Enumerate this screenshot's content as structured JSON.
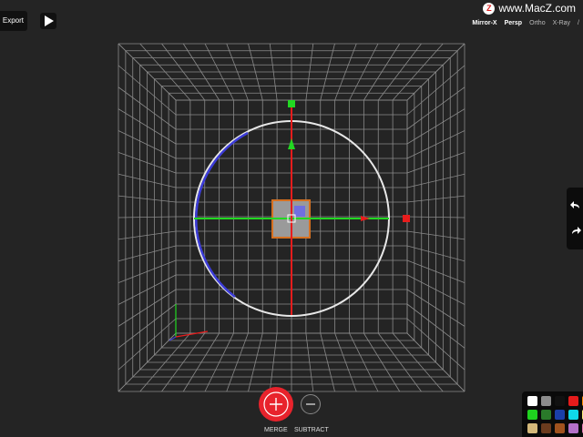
{
  "toolbar": {
    "export_label": "Export",
    "play_icon": "play-icon"
  },
  "watermark": {
    "text": "www.MacZ.com",
    "logo_glyph": "Z"
  },
  "view_modes": [
    {
      "label": "Mirror-X",
      "active": true
    },
    {
      "label": "Persp",
      "active": true
    },
    {
      "label": "Ortho",
      "active": false
    },
    {
      "label": "X-Ray",
      "active": false
    },
    {
      "label": "/",
      "active": false
    }
  ],
  "actions": {
    "merge_label": "MERGE",
    "subtract_label": "SUBTRACT"
  },
  "history": {
    "undo_icon": "undo-icon",
    "redo_icon": "redo-icon"
  },
  "palette": {
    "colors": [
      "#ffffff",
      "#8c8c8c",
      "#111111",
      "#e41b1b",
      "#ff8c00",
      "#1fd11f",
      "#2a7a2a",
      "#1a3fa8",
      "#0fd8e8",
      "#fff07a",
      "#d4b87a",
      "#6b3b1e",
      "#a0521e",
      "#b470c8",
      "#e87ab8"
    ]
  },
  "scene": {
    "gizmo_colors": {
      "x": "#e81c1c",
      "y": "#22d822",
      "z": "#3c3cd8",
      "ring": "#e8e8e8"
    },
    "object_color": "#9a9a9a",
    "object_outline": "#d67020",
    "grid_color": "#8a8a8a"
  }
}
